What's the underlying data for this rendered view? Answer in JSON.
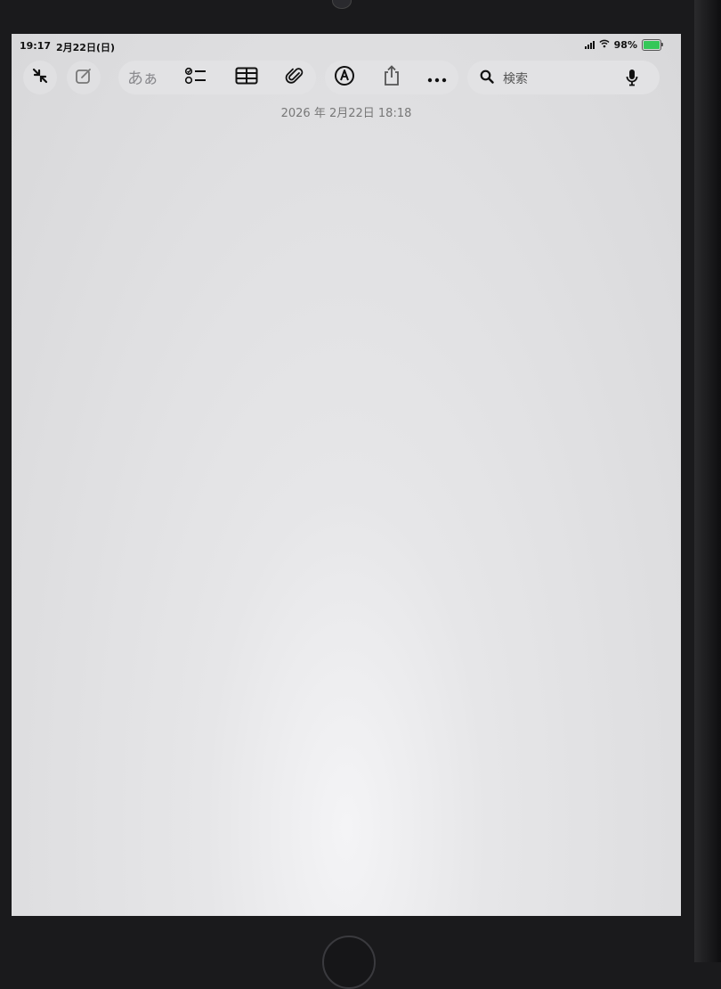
{
  "status_bar": {
    "time": "19:17",
    "date": "2月22日(日)",
    "battery_percent": "98%",
    "battery_level": 0.98,
    "battery_charging": true,
    "icons": [
      "signal-icon",
      "wifi-icon",
      "battery-icon"
    ]
  },
  "toolbar": {
    "left_buttons": [
      "collapse-icon",
      "compose-icon"
    ],
    "text_format_label": "あぁ",
    "tools": [
      "checklist-icon",
      "table-icon",
      "attachment-icon",
      "markup-icon",
      "share-icon",
      "more-icon"
    ],
    "search": {
      "placeholder": "検索",
      "icons": [
        "search-icon",
        "microphone-icon"
      ]
    }
  },
  "note": {
    "date_line": "2026 年 2月22日 18:18",
    "body": ""
  },
  "colors": {
    "accent_battery": "#34c759",
    "toolbar_pill": "#e2e2e4",
    "background": "#e4e4e6"
  }
}
